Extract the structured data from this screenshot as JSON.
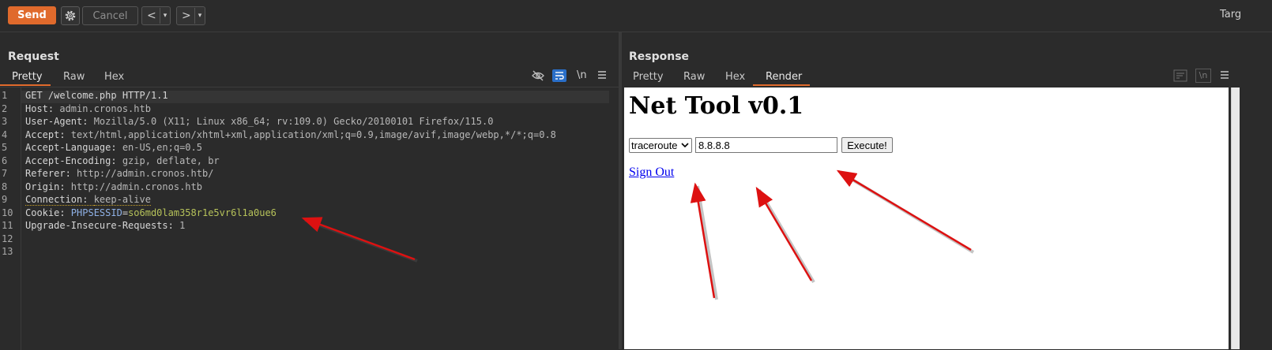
{
  "toolbar": {
    "send_label": "Send",
    "cancel_label": "Cancel",
    "back_label": "<",
    "forward_label": ">",
    "dropdown_glyph": "▾",
    "target_label": "Targ"
  },
  "layout_icons": [
    "split-horizontal-icon",
    "split-vertical-icon",
    "single-pane-icon"
  ],
  "request": {
    "title": "Request",
    "tabs": [
      "Pretty",
      "Raw",
      "Hex"
    ],
    "active_tab": "Pretty",
    "lines": [
      {
        "n": "1",
        "k": "GET /welcome.php HTTP/1.1",
        "v": ""
      },
      {
        "n": "2",
        "k": "Host: ",
        "v": "admin.cronos.htb"
      },
      {
        "n": "3",
        "k": "User-Agent: ",
        "v": "Mozilla/5.0 (X11; Linux x86_64; rv:109.0) Gecko/20100101 Firefox/115.0"
      },
      {
        "n": "4",
        "k": "Accept: ",
        "v": "text/html,application/xhtml+xml,application/xml;q=0.9,image/avif,image/webp,*/*;q=0.8"
      },
      {
        "n": "5",
        "k": "Accept-Language: ",
        "v": "en-US,en;q=0.5"
      },
      {
        "n": "6",
        "k": "Accept-Encoding: ",
        "v": "gzip, deflate, br"
      },
      {
        "n": "7",
        "k": "Referer: ",
        "v": "http://admin.cronos.htb/"
      },
      {
        "n": "8",
        "k": "Origin: ",
        "v": "http://admin.cronos.htb"
      },
      {
        "n": "9",
        "k": "Connection: ",
        "v": "keep-alive"
      },
      {
        "n": "10",
        "k": "Cookie: ",
        "cookie_key": "PHPSESSID",
        "cookie_eq": "=",
        "cookie_val": "so6md0lam358r1e5vr6l1a0ue6"
      },
      {
        "n": "11",
        "k": "Upgrade-Insecure-Requests: ",
        "v": "1"
      },
      {
        "n": "12",
        "k": "",
        "v": ""
      },
      {
        "n": "13",
        "k": "",
        "v": ""
      }
    ]
  },
  "response": {
    "title": "Response",
    "tabs": [
      "Pretty",
      "Raw",
      "Hex",
      "Render"
    ],
    "active_tab": "Render",
    "render": {
      "heading": "Net Tool v0.1",
      "select_value": "traceroute",
      "input_value": "8.8.8.8",
      "execute_label": "Execute!",
      "signout_label": "Sign Out"
    }
  },
  "colors": {
    "accent": "#e06a2c",
    "annotation_arrow": "#dd1111",
    "active_layout": "#2a6fc9"
  }
}
